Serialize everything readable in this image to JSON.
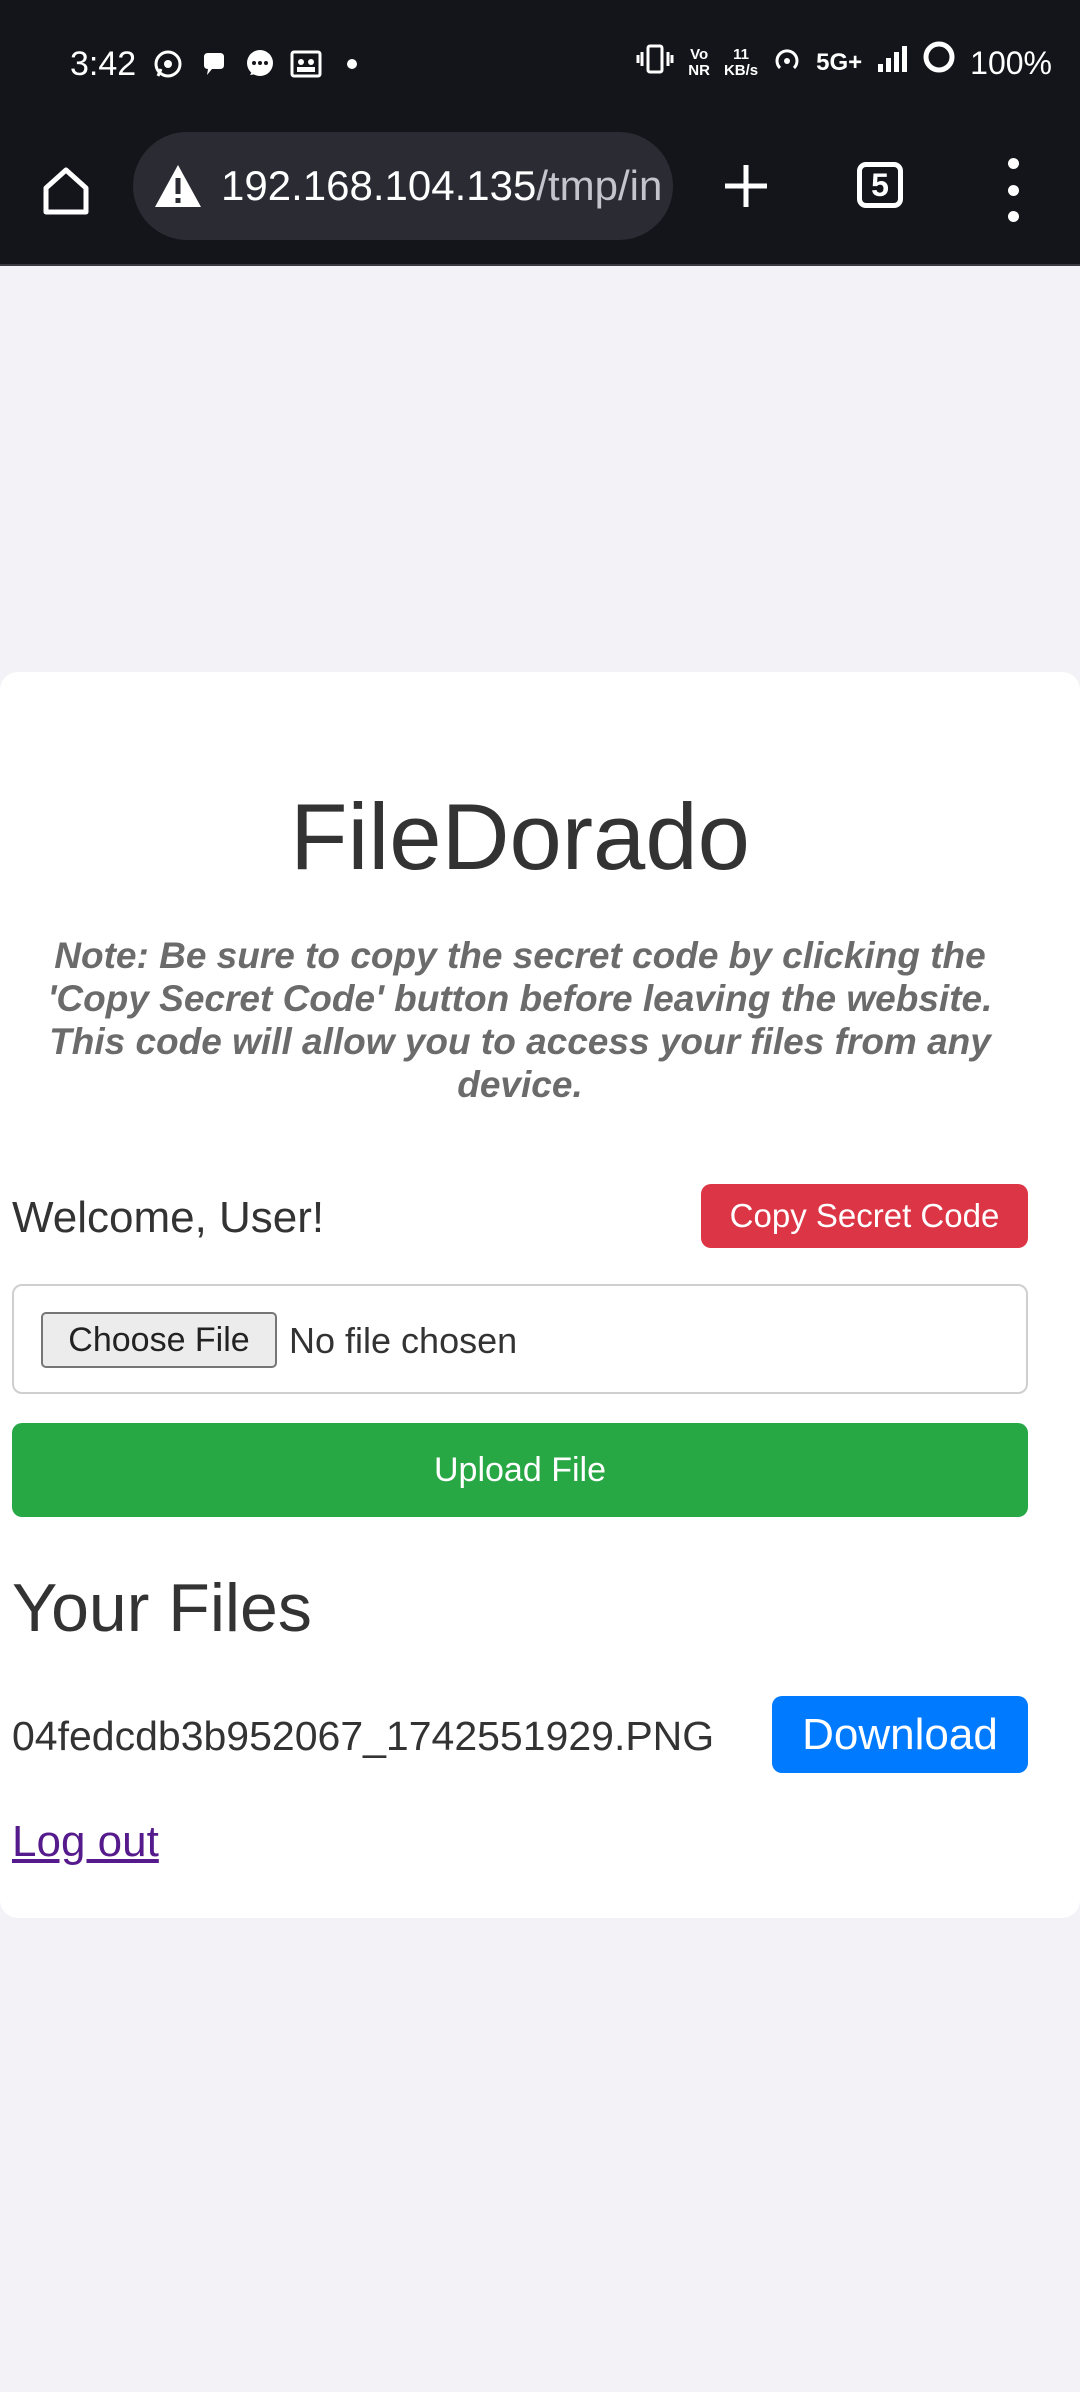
{
  "status_bar": {
    "time": "3:42",
    "notification_icons": [
      "whatsapp-icon",
      "chat-bubble-icon",
      "messages-icon",
      "gallery-icon",
      "dot-icon"
    ],
    "volte_top": "Vo",
    "volte_bottom": "NR",
    "speed_value": "11",
    "speed_unit": "KB/s",
    "network": "5G+",
    "battery": "100%"
  },
  "browser": {
    "url_host": "192.168.104.135",
    "url_path": "/tmp/in",
    "tab_count": "5"
  },
  "page": {
    "title": "FileDorado",
    "note": "Note: Be sure to copy the secret code by clicking the 'Copy Secret Code' button before leaving the website. This code will allow you to access your files from any device.",
    "welcome": "Welcome, User!",
    "copy_button": "Copy Secret Code",
    "choose_file_button": "Choose File",
    "no_file_text": "No file chosen",
    "upload_button": "Upload File",
    "files_heading": "Your Files",
    "files": [
      {
        "name": "04fedcdb3b952067_1742551929.PNG",
        "action": "Download"
      }
    ],
    "logout_link": "Log out"
  },
  "colors": {
    "danger": "#dc3545",
    "success": "#28a745",
    "primary": "#007bff",
    "page_background": "#f3f3f7",
    "browser_chrome": "#14151a"
  }
}
